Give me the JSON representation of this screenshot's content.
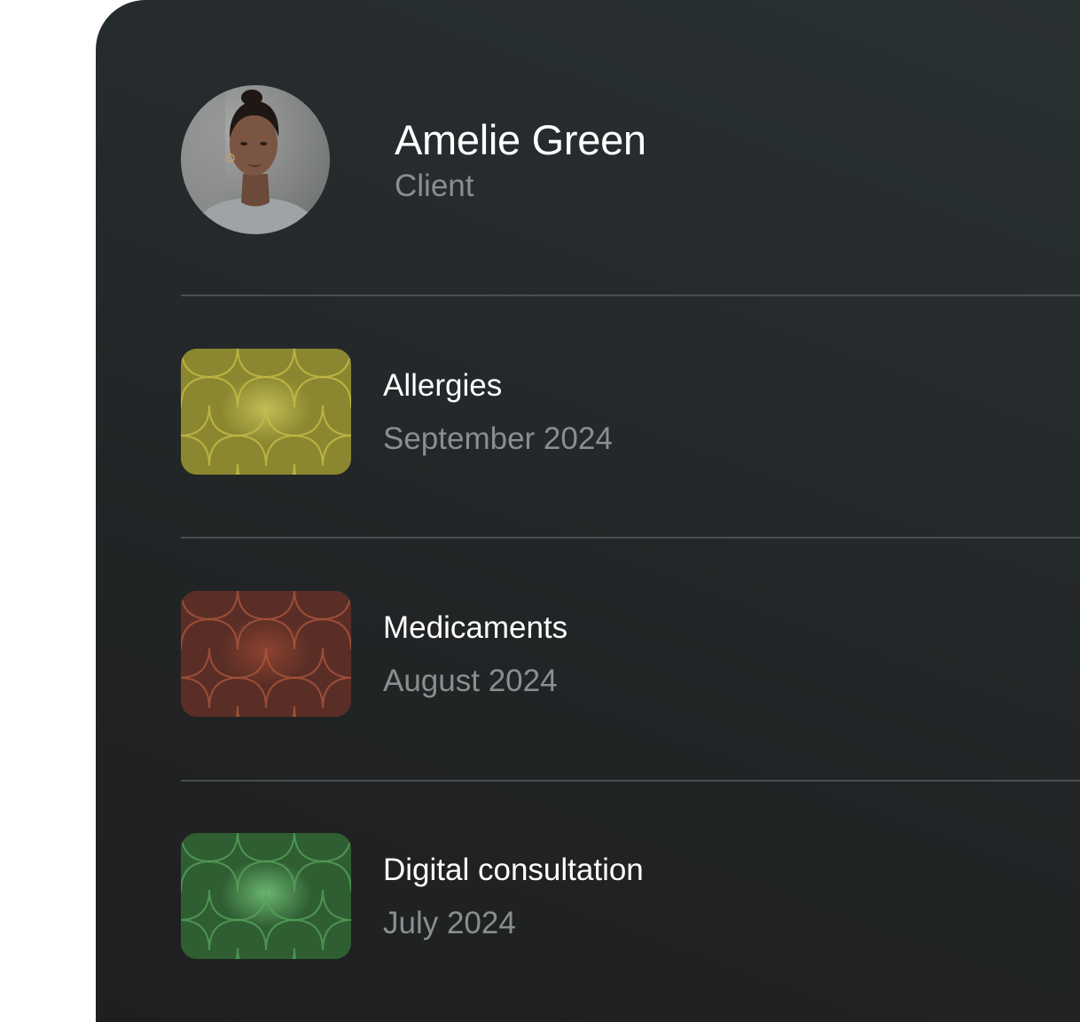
{
  "profile": {
    "name": "Amelie Green",
    "role": "Client",
    "avatar_icon": "avatar-photo"
  },
  "records": [
    {
      "title": "Allergies",
      "date": "September 2024",
      "icon": "star-pattern-icon",
      "color": "#8a8730",
      "glow": "#c2bd55",
      "line": "#c9c04a"
    },
    {
      "title": "Medicaments",
      "date": "August 2024",
      "icon": "star-pattern-icon",
      "color": "#5a2e26",
      "glow": "#8c4230",
      "line": "#b0583e"
    },
    {
      "title": "Digital consultation",
      "date": "July 2024",
      "icon": "star-pattern-icon",
      "color": "#2f5e33",
      "glow": "#6bb56f",
      "line": "#58a65c"
    }
  ],
  "colors": {
    "card_background": "#232728",
    "primary_text": "#ffffff",
    "secondary_text": "#8a8e8f",
    "divider": "#4a4e50"
  }
}
